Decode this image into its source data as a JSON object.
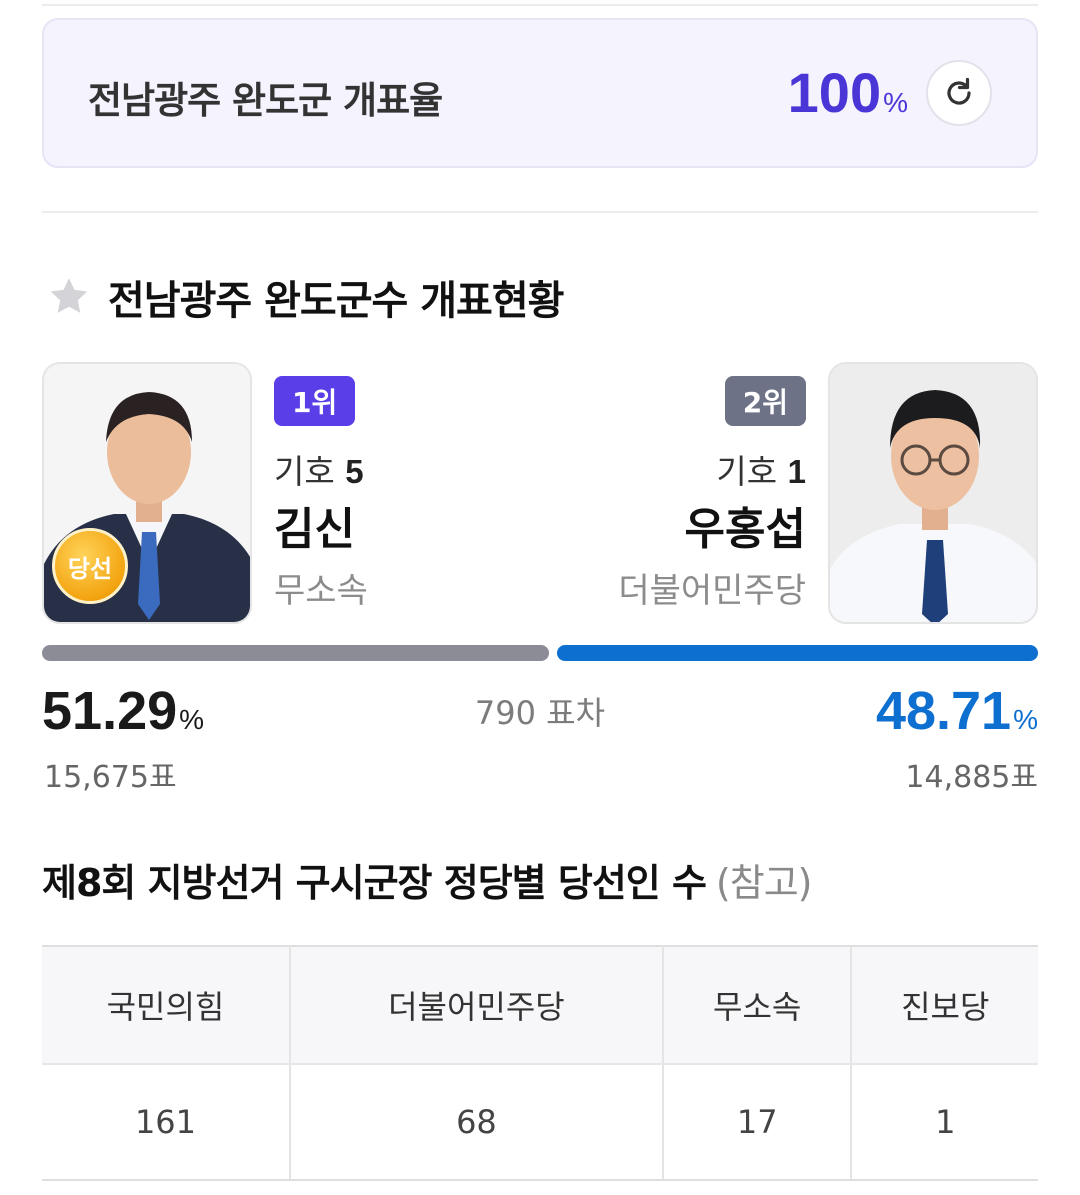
{
  "rate": {
    "title": "전남광주 완도군 개표율",
    "value": "100",
    "unit": "%"
  },
  "section": {
    "title": "전남광주 완도군수 개표현황"
  },
  "candidates": [
    {
      "rank": "1위",
      "number_prefix": "기호",
      "number": "5",
      "name": "김신",
      "party": "무소속",
      "winner_badge": "당선",
      "percent": "51.29",
      "percent_unit": "%",
      "votes": "15,675표",
      "vote_share": 51.29,
      "bar_color": "#8c8c96"
    },
    {
      "rank": "2위",
      "number_prefix": "기호",
      "number": "1",
      "name": "우홍섭",
      "party": "더불어민주당",
      "percent": "48.71",
      "percent_unit": "%",
      "votes": "14,885표",
      "vote_share": 48.71,
      "bar_color": "#0d6fd0"
    }
  ],
  "margin": "790 표차",
  "party_winners": {
    "title": "제8회 지방선거 구시군장 정당별 당선인 수",
    "note": "(참고)",
    "headers": [
      "국민의힘",
      "더불어민주당",
      "무소속",
      "진보당"
    ],
    "values": [
      "161",
      "68",
      "17",
      "1"
    ]
  },
  "colors": {
    "accent": "#4a35d6",
    "rank1": "#5a3ee8",
    "rank2": "#6e7286",
    "blue": "#0d6fd0"
  },
  "icons": {
    "refresh": "refresh-icon",
    "star": "star-icon"
  }
}
